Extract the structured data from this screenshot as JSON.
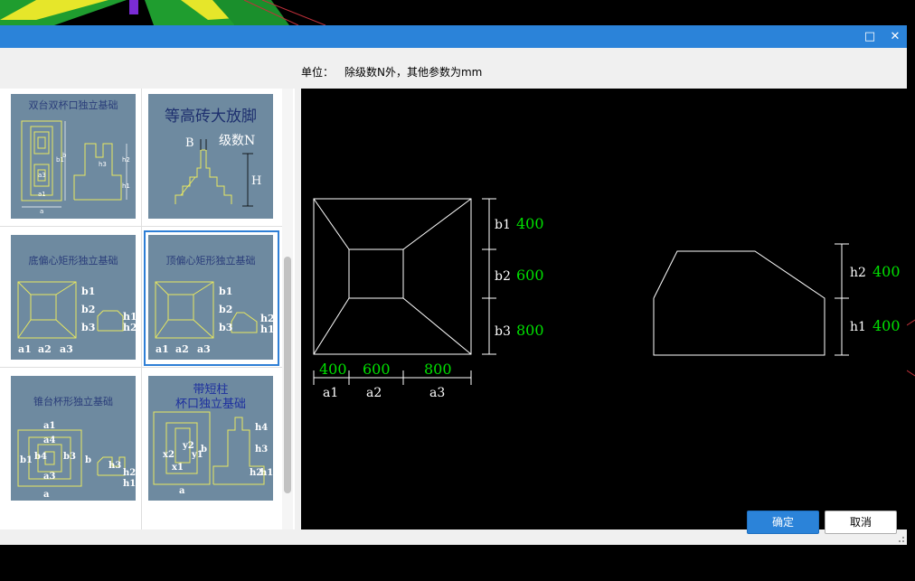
{
  "window": {
    "maximize_icon": "□",
    "close_icon": "✕"
  },
  "unit_label": "单位：",
  "unit_text": "除级数N外，其他参数为mm",
  "gallery": {
    "tiles": [
      {
        "title": "双台双杯口独立基础"
      },
      {
        "title": "等高砖大放脚",
        "labels": {
          "b": "B",
          "n": "级数N",
          "h": "H"
        }
      },
      {
        "title": "底偏心矩形独立基础",
        "labels": {
          "b1": "b1",
          "b2": "b2",
          "b3": "b3",
          "h1": "h1",
          "h2": "h2",
          "a1": "a1",
          "a2": "a2",
          "a3": "a3"
        }
      },
      {
        "title": "顶偏心矩形独立基础",
        "labels": {
          "b1": "b1",
          "b2": "b2",
          "b3": "b3",
          "h1": "h1",
          "h2": "h2",
          "a1": "a1",
          "a2": "a2",
          "a3": "a3"
        }
      },
      {
        "title": "锥台杯形独立基础",
        "labels": {
          "a": "a",
          "a1": "a1",
          "a3": "a3",
          "a4": "a4",
          "b": "b",
          "b1": "b1",
          "b4": "b4",
          "b3": "b3",
          "h3": "h3",
          "h2": "h2",
          "h1": "h1"
        }
      },
      {
        "title_line1": "带短柱",
        "title_line2": "杯口独立基础",
        "labels": {
          "a": "a",
          "x1": "x1",
          "x2": "x2",
          "y1": "y1",
          "y2": "y2",
          "b": "b",
          "h1": "h1",
          "h2": "h2",
          "h3": "h3",
          "h4": "h4"
        }
      }
    ],
    "selected_index": 3
  },
  "preview": {
    "b_labels": [
      "b1",
      "b2",
      "b3"
    ],
    "b_values": [
      "400",
      "600",
      "800"
    ],
    "a_labels": [
      "a1",
      "a2",
      "a3"
    ],
    "a_values": [
      "400",
      "600",
      "800"
    ],
    "h_labels": [
      "h2",
      "h1"
    ],
    "h_values": [
      "400",
      "400"
    ],
    "value_color": "#00e000",
    "label_color": "#ffffff"
  },
  "buttons": {
    "ok": "确定",
    "cancel": "取消"
  }
}
